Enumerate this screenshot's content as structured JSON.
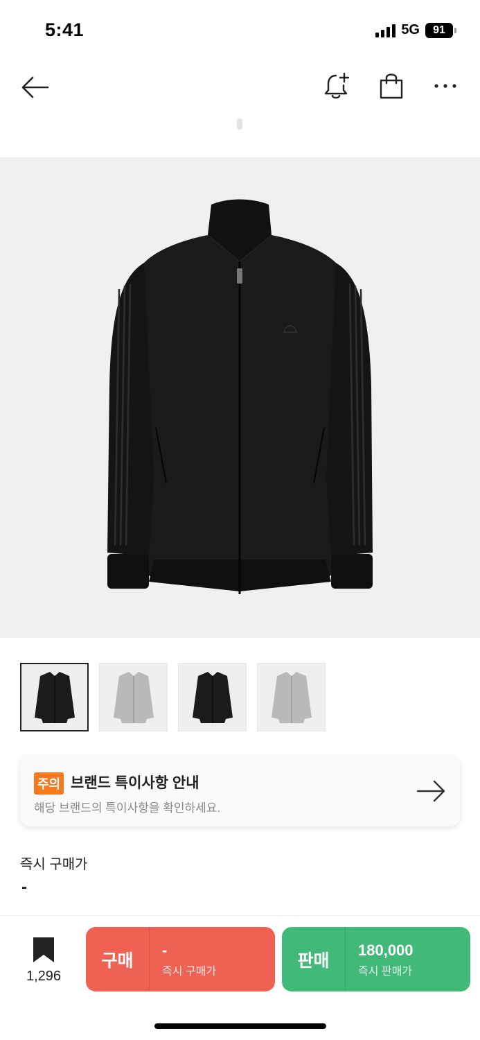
{
  "status_bar": {
    "time": "5:41",
    "network": "5G",
    "battery": "91"
  },
  "nav": {
    "back_icon": "arrow-left-icon",
    "alert_icon": "bell-plus-icon",
    "bag_icon": "shopping-bag-icon",
    "more_icon": "more-horizontal-icon"
  },
  "product": {
    "image": "black-track-jacket",
    "thumbnails": [
      {
        "color": "black",
        "selected": true
      },
      {
        "color": "silver",
        "selected": false
      },
      {
        "color": "black",
        "selected": false
      },
      {
        "color": "silver",
        "selected": false
      }
    ]
  },
  "notice": {
    "badge": "주의",
    "title": "브랜드 특이사항 안내",
    "subtitle": "해당 브랜드의 특이사항을 확인하세요."
  },
  "instant_buy": {
    "label": "즉시 구매가",
    "value": "-"
  },
  "bottom_bar": {
    "bookmark_count": "1,296",
    "buy": {
      "label": "구매",
      "price": "-",
      "sub": "즉시 구매가"
    },
    "sell": {
      "label": "판매",
      "price": "180,000",
      "sub": "즉시 판매가"
    }
  },
  "colors": {
    "buy": "#ef6253",
    "sell": "#41b979",
    "badge": "#f47a20"
  }
}
